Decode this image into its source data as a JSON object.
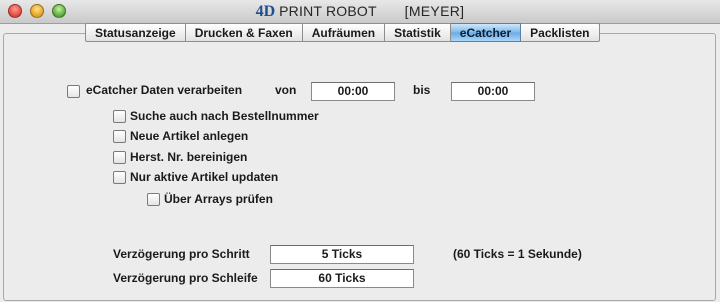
{
  "window": {
    "title_logo": "4D",
    "title_text": "PRINT ROBOT",
    "title_user": "[MEYER]"
  },
  "tabs": [
    {
      "label": "Statusanzeige",
      "active": false
    },
    {
      "label": "Drucken & Faxen",
      "active": false
    },
    {
      "label": "Aufräumen",
      "active": false
    },
    {
      "label": "Statistik",
      "active": false
    },
    {
      "label": "eCatcher",
      "active": true
    },
    {
      "label": "Packlisten",
      "active": false
    }
  ],
  "ecatcher": {
    "main_checkbox_label": "eCatcher Daten verarbeiten",
    "main_checkbox_checked": false,
    "von_label": "von",
    "von_value": "00:00",
    "bis_label": "bis",
    "bis_value": "00:00",
    "options": [
      {
        "label": "Suche auch nach Bestellnummer",
        "checked": false
      },
      {
        "label": "Neue Artikel anlegen",
        "checked": false
      },
      {
        "label": "Herst. Nr. bereinigen",
        "checked": false
      },
      {
        "label": "Nur aktive Artikel updaten",
        "checked": false
      },
      {
        "label": "Über Arrays prüfen",
        "checked": false
      }
    ],
    "delay_step_label": "Verzögerung pro Schritt",
    "delay_step_value": "5 Ticks",
    "delay_step_note": "(60 Ticks = 1 Sekunde)",
    "delay_loop_label": "Verzögerung pro Schleife",
    "delay_loop_value": "60 Ticks"
  },
  "colors": {
    "active_tab": "#7eb9ea",
    "background": "#ececec"
  }
}
